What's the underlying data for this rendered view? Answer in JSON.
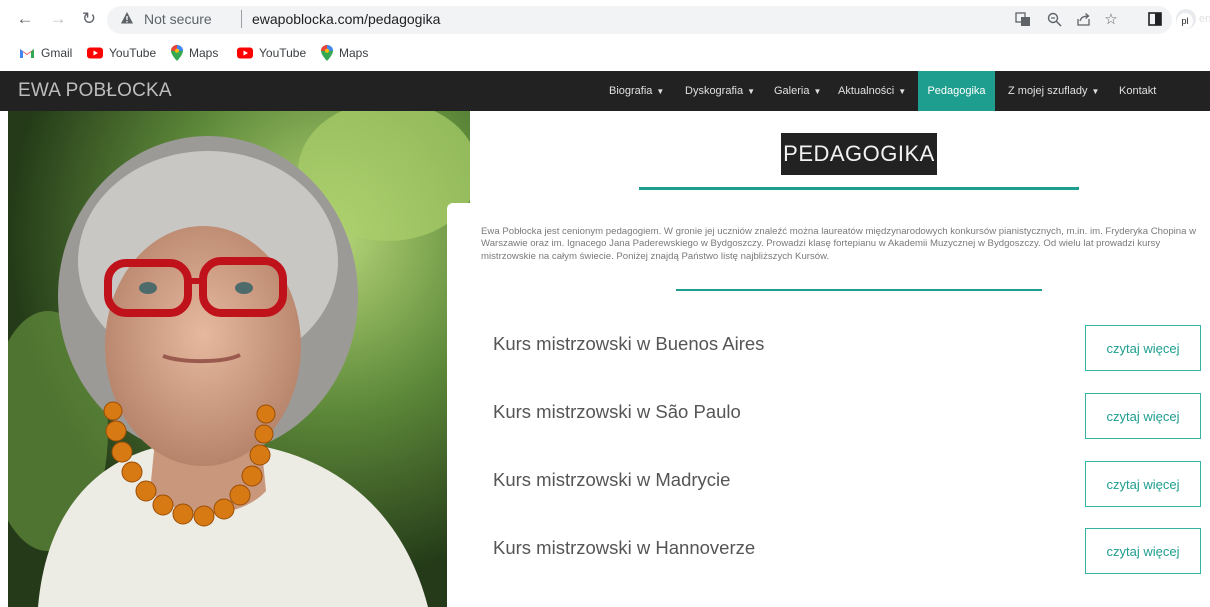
{
  "browser": {
    "insecure_label": "Not secure",
    "url_host": "ewapoblocka.com",
    "url_path": "/pedagogika",
    "bookmarks": [
      {
        "label": "Gmail",
        "icon": "gmail-icon"
      },
      {
        "label": "YouTube",
        "icon": "youtube-icon"
      },
      {
        "label": "Maps",
        "icon": "maps-icon"
      },
      {
        "label": "YouTube",
        "icon": "youtube-icon"
      },
      {
        "label": "Maps",
        "icon": "maps-icon"
      }
    ]
  },
  "site": {
    "logo": "EWA POBŁOCKA",
    "menu": [
      {
        "label": "Biografia",
        "dropdown": true
      },
      {
        "label": "Dyskografia",
        "dropdown": true
      },
      {
        "label": "Galeria",
        "dropdown": true
      },
      {
        "label": "Aktualności",
        "dropdown": true
      },
      {
        "label": "Pedagogika",
        "dropdown": false,
        "active": true
      },
      {
        "label": "Z mojej szuflady",
        "dropdown": true
      },
      {
        "label": "Kontakt",
        "dropdown": false
      }
    ],
    "lang_current": "pl",
    "lang_other": "en"
  },
  "page": {
    "title": "PEDAGOGIKA",
    "intro": "Ewa Pobłocka jest cenionym pedagogiem. W gronie jej uczniów znaleźć można laureatów międzynarodowych konkursów pianistycznych, m.in. im. Fryderyka Chopina w Warszawie oraz im. Ignacego Jana Paderewskiego w Bydgoszczy. Prowadzi klasę fortepianu w Akademii Muzycznej w Bydgoszczy. Od wielu lat prowadzi kursy mistrzowskie na całym świecie. Poniżej znajdą Państwo listę najbliższych Kursów.",
    "courses": [
      {
        "title": "Kurs mistrzowski w Buenos Aires",
        "button": "czytaj więcej"
      },
      {
        "title": "Kurs mistrzowski w São Paulo",
        "button": "czytaj więcej"
      },
      {
        "title": "Kurs mistrzowski w Madrycie",
        "button": "czytaj więcej"
      },
      {
        "title": "Kurs mistrzowski w Hannoverze",
        "button": "czytaj więcej"
      }
    ]
  },
  "colors": {
    "accent": "#1e9e8e",
    "header_bg": "#222222"
  }
}
